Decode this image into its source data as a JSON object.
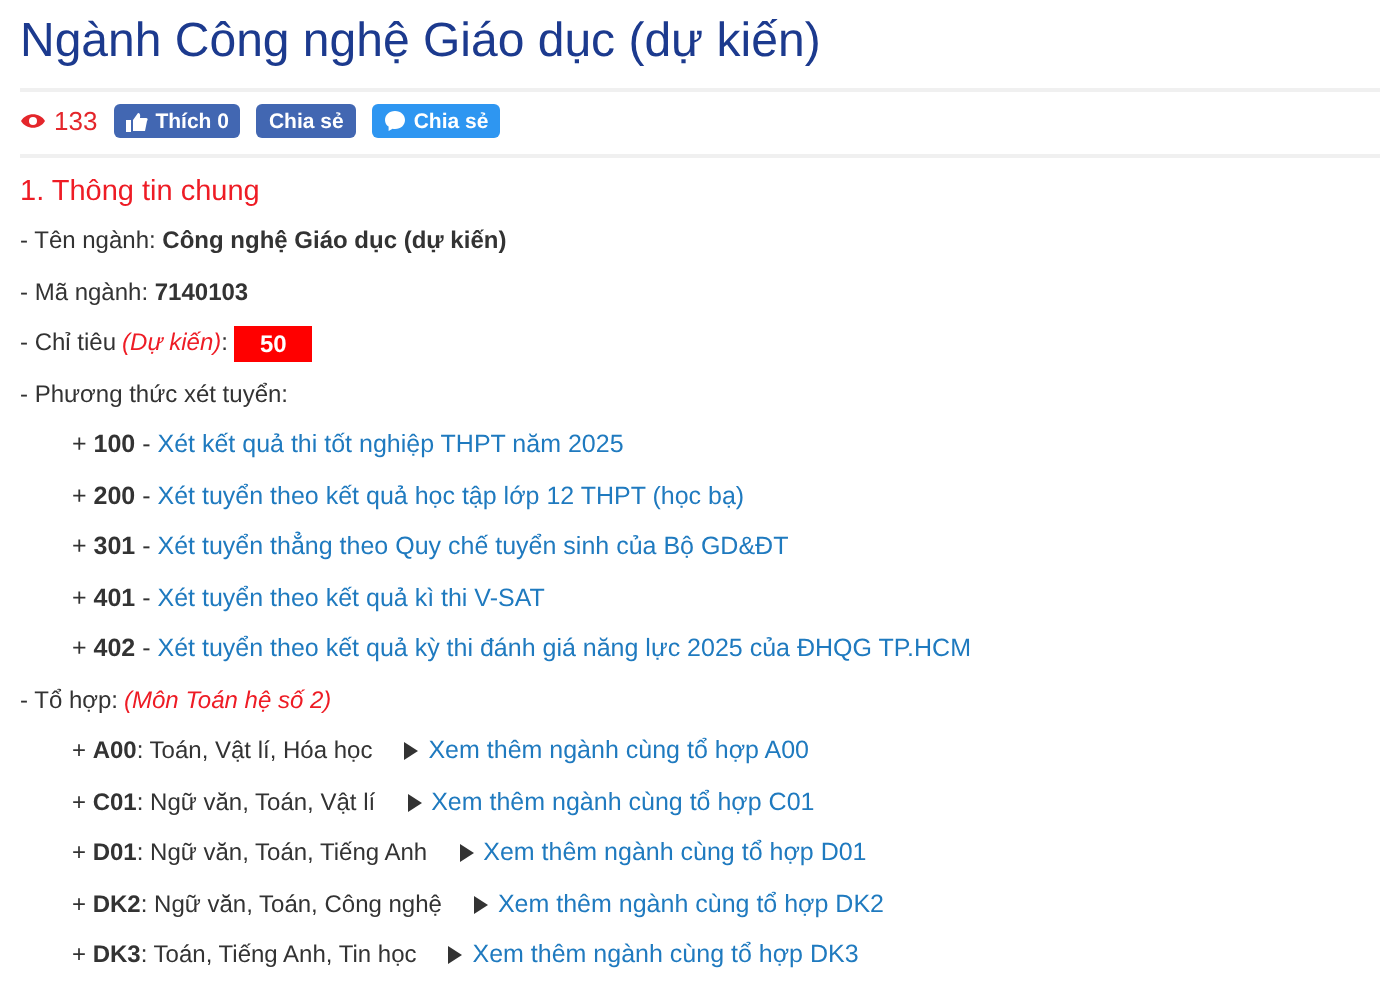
{
  "title": "Ngành Công nghệ Giáo dục (dự kiến)",
  "stats": {
    "views": "133",
    "buttons": [
      {
        "kind": "like",
        "label": "Thích 0"
      },
      {
        "kind": "share",
        "label": "Chia sẻ"
      },
      {
        "kind": "messenger",
        "label": "Chia sẻ"
      }
    ]
  },
  "section": {
    "heading": "1. Thông tin chung",
    "name_line": "- Tên ngành: **Công nghệ Giáo dục (dự kiến)**",
    "code_line": "- Mã ngành: **7140103**",
    "quota": {
      "label": "- Chỉ tiêu",
      "note": "(Dự kiến)",
      "colon": ":",
      "value": "50"
    },
    "methods_label": "- Phương thức xét tuyển:",
    "methods": [
      {
        "code": "+ **100** - ",
        "text": "Xét kết quả thi tốt nghiệp THPT năm 2025"
      },
      {
        "code": "+ **200** - ",
        "text": "Xét tuyển theo kết quả học tập lớp 12 THPT (học bạ)"
      },
      {
        "code": "+ **301** - ",
        "text": "Xét tuyển thẳng theo Quy chế tuyển sinh của Bộ GD&ĐT"
      },
      {
        "code": "+ **401** - ",
        "text": "Xét tuyển theo kết quả kì thi V-SAT"
      },
      {
        "code": "+ **402** - ",
        "text": "Xét tuyển theo kết quả kỳ thi đánh giá năng lực 2025 của ĐHQG TP.HCM"
      }
    ],
    "combos_label": "- Tổ hợp:",
    "combos_note": "(Môn Toán hệ số 2)",
    "combos": [
      {
        "subjects": "+ **A00**: Toán, Vật lí, Hóa học",
        "link": "Xem thêm ngành cùng tổ hợp A00"
      },
      {
        "subjects": "+ **C01**: Ngữ văn, Toán, Vật lí",
        "link": "Xem thêm ngành cùng tổ hợp C01"
      },
      {
        "subjects": "+ **D01**: Ngữ văn, Toán, Tiếng Anh",
        "link": "Xem thêm ngành cùng tổ hợp D01"
      },
      {
        "subjects": "+ **DK2**: Ngữ văn, Toán, Công nghệ",
        "link": "Xem thêm ngành cùng tổ hợp DK2"
      },
      {
        "subjects": "+ **DK3**: Toán, Tiếng Anh, Tin học",
        "link": "Xem thêm ngành cùng tổ hợp DK3"
      }
    ]
  }
}
